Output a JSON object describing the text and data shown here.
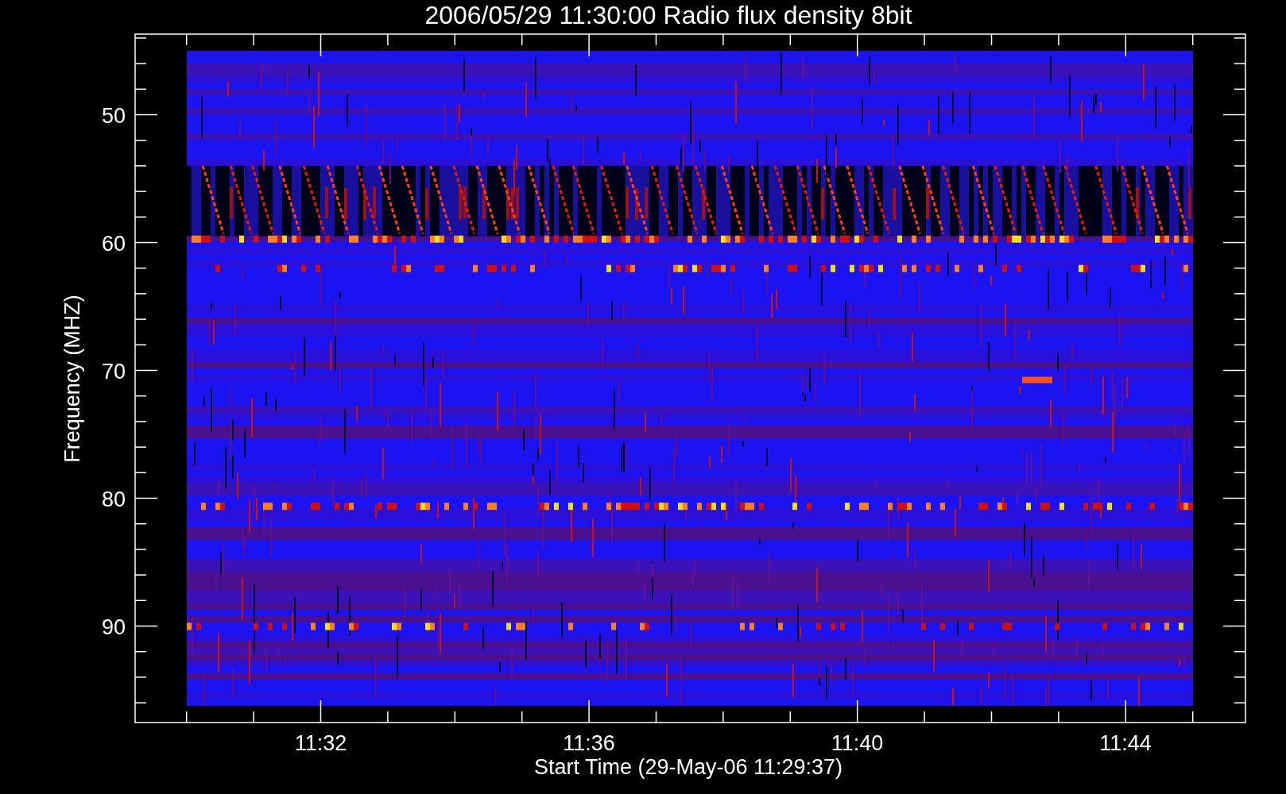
{
  "plot": {
    "title": "2006/05/29 11:30:00 Radio flux density 8bit",
    "ylabel": "Frequency (MHZ)",
    "xlabel": "Start Time (29-May-06 11:29:37)",
    "yticks": [
      "50",
      "60",
      "70",
      "80",
      "90"
    ],
    "xticks": [
      "11:32",
      "11:36",
      "11:40",
      "11:44"
    ]
  }
}
